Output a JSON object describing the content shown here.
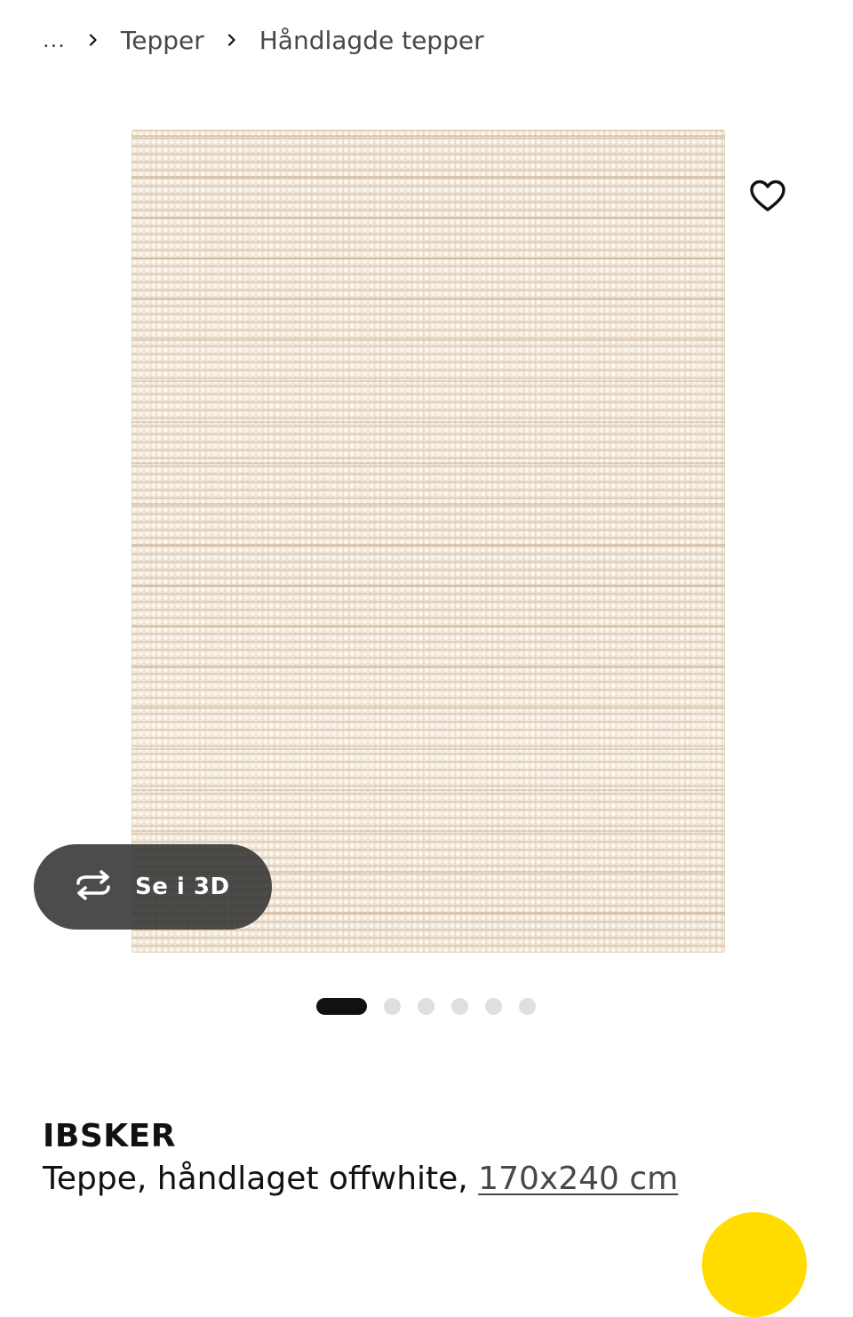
{
  "breadcrumb": {
    "ellipsis": "...",
    "items": [
      "Tepper",
      "Håndlagde tepper"
    ]
  },
  "gallery": {
    "view3d_label": "Se i 3D",
    "favorite_icon": "heart-outline-icon",
    "view3d_icon": "rotate-arrows-icon",
    "page_count": 6,
    "active_page": 1
  },
  "product": {
    "name": "IBSKER",
    "description": "Teppe, håndlaget offwhite, ",
    "size": "170x240 cm"
  },
  "colors": {
    "text": "#111111",
    "secondary_text": "#484848",
    "pill_background": "#333333",
    "dot_active": "#111111",
    "dot_inactive": "#dfdfdf",
    "accent": "#ffdb00"
  }
}
